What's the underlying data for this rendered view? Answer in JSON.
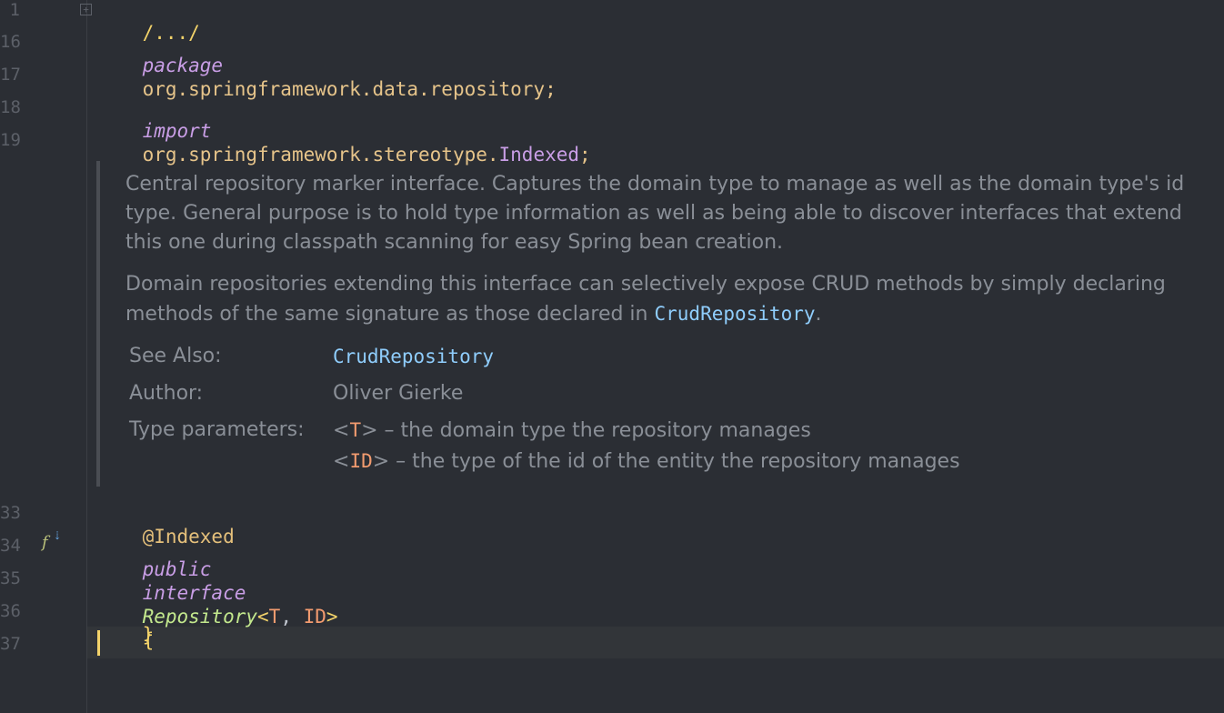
{
  "gutter": {
    "line_numbers": [
      "1",
      "16",
      "17",
      "18",
      "19",
      "33",
      "34",
      "35",
      "36",
      "37"
    ]
  },
  "code": {
    "folded_header": "/.../",
    "package_kw": "package",
    "package_name": "org.springframework.data.repository",
    "semicolon": ";",
    "import_kw": "import",
    "import_pkg": "org.springframework.stereotype.",
    "import_class": "Indexed",
    "annotation": "@Indexed",
    "public_kw": "public",
    "interface_kw": "interface",
    "interface_name": "Repository",
    "lt": "<",
    "type_param_t": "T",
    "comma": ", ",
    "type_param_id": "ID",
    "gt": ">",
    "open_brace": "{",
    "close_brace": "}"
  },
  "doc": {
    "para1_line1": "Central repository marker interface. Captures the domain type to manage as well as the domain type's id",
    "para1_line2": "type. General purpose is to hold type information as well as being able to discover interfaces that extend",
    "para1_line3": "this one during classpath scanning for easy Spring bean creation.",
    "para2_line1": "Domain repositories extending this interface can selectively expose CRUD methods by simply declaring",
    "para2_line2_prefix": "methods of the same signature as those declared in ",
    "para2_link": "CrudRepository",
    "para2_suffix": ".",
    "see_also_label": "See Also:",
    "see_also_value": "CrudRepository",
    "author_label": "Author:",
    "author_value": "Oliver Gierke",
    "type_params_label": "Type parameters:",
    "tp1_lt": "<",
    "tp1_name": "T",
    "tp1_gt": ">",
    "tp1_desc": " – the domain type the repository manages",
    "tp2_lt": "<",
    "tp2_name": "ID",
    "tp2_gt": ">",
    "tp2_desc": " – the type of the id of the entity the repository manages"
  },
  "colors": {
    "background": "#2b2e34",
    "keyword": "#c99ee6",
    "package": "#e6c48a",
    "interface_name": "#c3e88d",
    "type_param": "#f29b6f",
    "doc_text": "#8a8f97",
    "doc_link": "#8fcdfc",
    "caret": "#f3d36a"
  },
  "icons": {
    "fold": "fold-plus-icon",
    "gutter_override": "implemented-function-icon"
  }
}
